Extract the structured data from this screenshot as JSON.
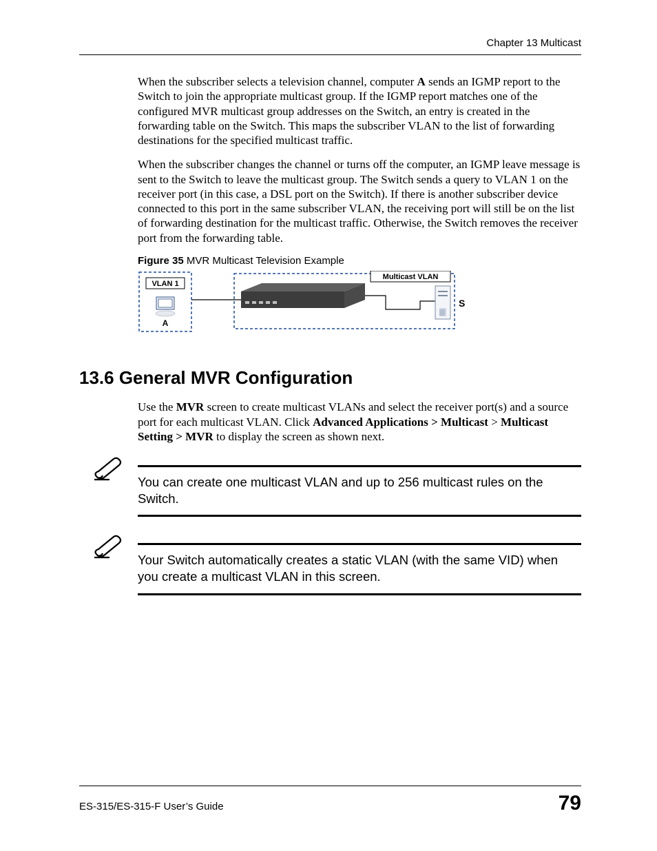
{
  "header": {
    "chapter_label": "Chapter 13 Multicast"
  },
  "paragraphs": {
    "p1_pre": "When the subscriber selects a television channel, computer ",
    "p1_bold": "A",
    "p1_post": " sends an IGMP report to the Switch to join the appropriate multicast group. If the IGMP report matches one of the configured MVR multicast group addresses on the Switch, an entry is created in the forwarding table on the Switch. This maps the subscriber VLAN to the list of forwarding destinations for the specified multicast traffic.",
    "p2": "When the subscriber changes the channel or turns off the computer, an IGMP leave message is sent to the Switch to leave the multicast group. The Switch sends a query to VLAN 1 on the receiver port (in this case, a DSL port on the Switch). If there is another subscriber device connected to this port in the same subscriber VLAN, the receiving port will still be on the list of forwarding destination for the multicast traffic. Otherwise, the Switch removes the receiver port from the forwarding table."
  },
  "figure": {
    "label_num": "Figure 35",
    "label_title": "   MVR Multicast Television Example",
    "vlan1_label": "VLAN 1",
    "multicast_label": "Multicast VLAN",
    "computer_label": "A",
    "server_label": "S"
  },
  "section": {
    "heading": "13.6  General MVR Configuration",
    "body_pre": "Use the ",
    "body_b1": "MVR",
    "body_mid1": " screen to create multicast VLANs and select the receiver port(s) and a source port for each multicast VLAN. Click ",
    "body_b2": "Advanced Applications > Multicast",
    "body_mid2": " > ",
    "body_b3": "Multicast Setting > MVR",
    "body_post": " to display the screen as shown next."
  },
  "notes": {
    "n1": "You can create one multicast VLAN and up to 256 multicast rules on the Switch.",
    "n2": "Your Switch automatically creates a static VLAN (with the same VID) when you create a multicast VLAN in this screen."
  },
  "footer": {
    "guide": "ES-315/ES-315-F User’s Guide",
    "page": "79"
  }
}
